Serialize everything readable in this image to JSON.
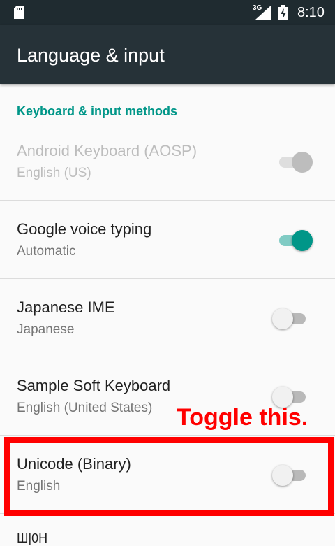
{
  "status_bar": {
    "network_type": "3G",
    "time": "8:10",
    "icons": [
      "sd-card-icon",
      "signal-icon",
      "battery-charging-icon"
    ]
  },
  "app_bar": {
    "title": "Language & input"
  },
  "section": {
    "header": "Keyboard & input methods"
  },
  "keyboards": [
    {
      "title": "Android Keyboard (AOSP)",
      "subtitle": "English (US)",
      "enabled": true,
      "switch_state": "on-disabled"
    },
    {
      "title": "Google voice typing",
      "subtitle": "Automatic",
      "enabled": true,
      "switch_state": "on"
    },
    {
      "title": "Japanese IME",
      "subtitle": "Japanese",
      "enabled": false,
      "switch_state": "off"
    },
    {
      "title": "Sample Soft Keyboard",
      "subtitle": "English (United States)",
      "enabled": false,
      "switch_state": "off"
    },
    {
      "title": "Unicode (Binary)",
      "subtitle": "English",
      "enabled": false,
      "switch_state": "off"
    }
  ],
  "annotation": {
    "text": "Toggle this.",
    "color": "#ff0000"
  },
  "partial_row": {
    "title": "Ш|0Н"
  },
  "colors": {
    "accent": "#009688",
    "app_bar": "#263238",
    "status_bar": "#1f2b30"
  }
}
